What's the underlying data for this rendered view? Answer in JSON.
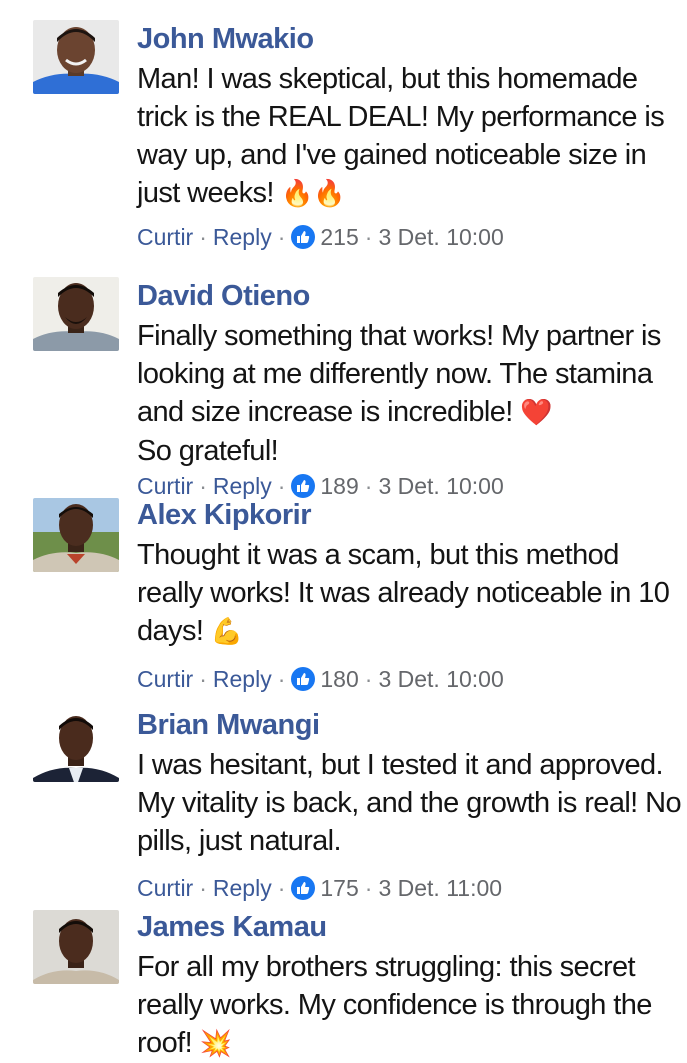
{
  "comments": [
    {
      "name": "John Mwakio",
      "text": "Man! I was skeptical, but this homemade trick is the REAL DEAL! My performance is way up, and I've gained noticeable size in just weeks!",
      "emoji": "🔥🔥",
      "actions": {
        "like": "Curtir",
        "reply": "Reply"
      },
      "likes": "215",
      "timestamp": "3 Det. 10:00"
    },
    {
      "name": "David Otieno",
      "text": "Finally something that works! My partner is looking at me differently now. The stamina and size increase is incredible!",
      "emoji": "❤️",
      "text_after": "So grateful!",
      "actions": {
        "like": "Curtir",
        "reply": "Reply"
      },
      "likes": "189",
      "timestamp": "3 Det. 10:00"
    },
    {
      "name": "Alex Kipkorir",
      "text": "Thought it was a scam, but this method really works! It was already noticeable in 10 days!",
      "emoji": "💪",
      "actions": {
        "like": "Curtir",
        "reply": "Reply"
      },
      "likes": "180",
      "timestamp": "3 Det. 10:00"
    },
    {
      "name": "Brian Mwangi",
      "text": "I was hesitant, but I tested it and approved. My vitality is back, and the growth is real! No pills, just natural.",
      "actions": {
        "like": "Curtir",
        "reply": "Reply"
      },
      "likes": "175",
      "timestamp": "3 Det. 11:00"
    },
    {
      "name": "James Kamau",
      "text": "For all my brothers struggling: this secret really works. My confidence is through the roof!",
      "emoji": "💥"
    }
  ],
  "colors": {
    "name": "#3b5998",
    "like_badge": "#1877f2",
    "text": "#141414",
    "meta_muted": "#65676b"
  }
}
